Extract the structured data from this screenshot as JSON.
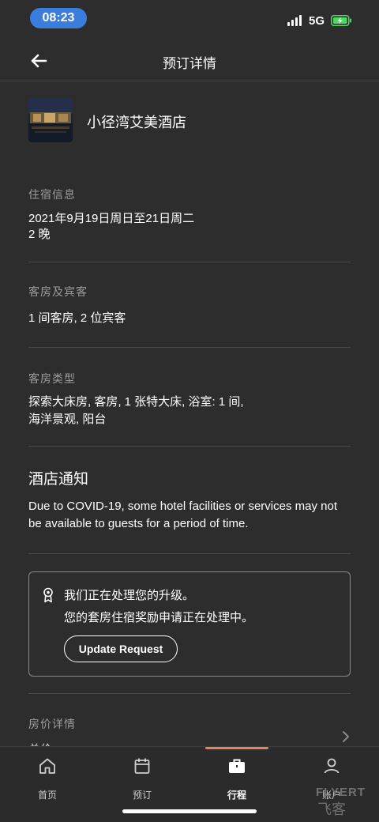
{
  "status": {
    "time": "08:23",
    "network": "5G"
  },
  "nav": {
    "title": "预订详情"
  },
  "hotel": {
    "name": "小径湾艾美酒店"
  },
  "stay": {
    "label": "住宿信息",
    "dates": "2021年9月19日周日至21日周二",
    "nights": "2 晚"
  },
  "rooms_guests": {
    "label": "客房及宾客",
    "value": "1 间客房, 2 位宾客"
  },
  "room_type": {
    "label": "客房类型",
    "value": "探索大床房, 客房, 1 张特大床, 浴室: 1 间, 海洋景观, 阳台"
  },
  "notice": {
    "title": "酒店通知",
    "body": "Due to COVID-19, some hotel facilities or services may not be available to guests for a period of time."
  },
  "upgrade": {
    "line1": "我们正在处理您的升级。",
    "line2": "您的套房住宿奖励申请正在处理中。",
    "button": "Update Request"
  },
  "rate": {
    "label": "房价详情",
    "peek": "总价"
  },
  "tabs": [
    {
      "label": "首页",
      "icon": "home-icon"
    },
    {
      "label": "预订",
      "icon": "calendar-icon"
    },
    {
      "label": "行程",
      "icon": "briefcase-icon",
      "active": true
    },
    {
      "label": "账户",
      "icon": "user-icon"
    }
  ],
  "watermark": {
    "line1": "FLYERT",
    "line2": "飞客"
  },
  "colors": {
    "background": "#2d2d2d",
    "time_pill": "#3b7ddd",
    "accent": "#e8825a",
    "battery": "#4cd964"
  }
}
